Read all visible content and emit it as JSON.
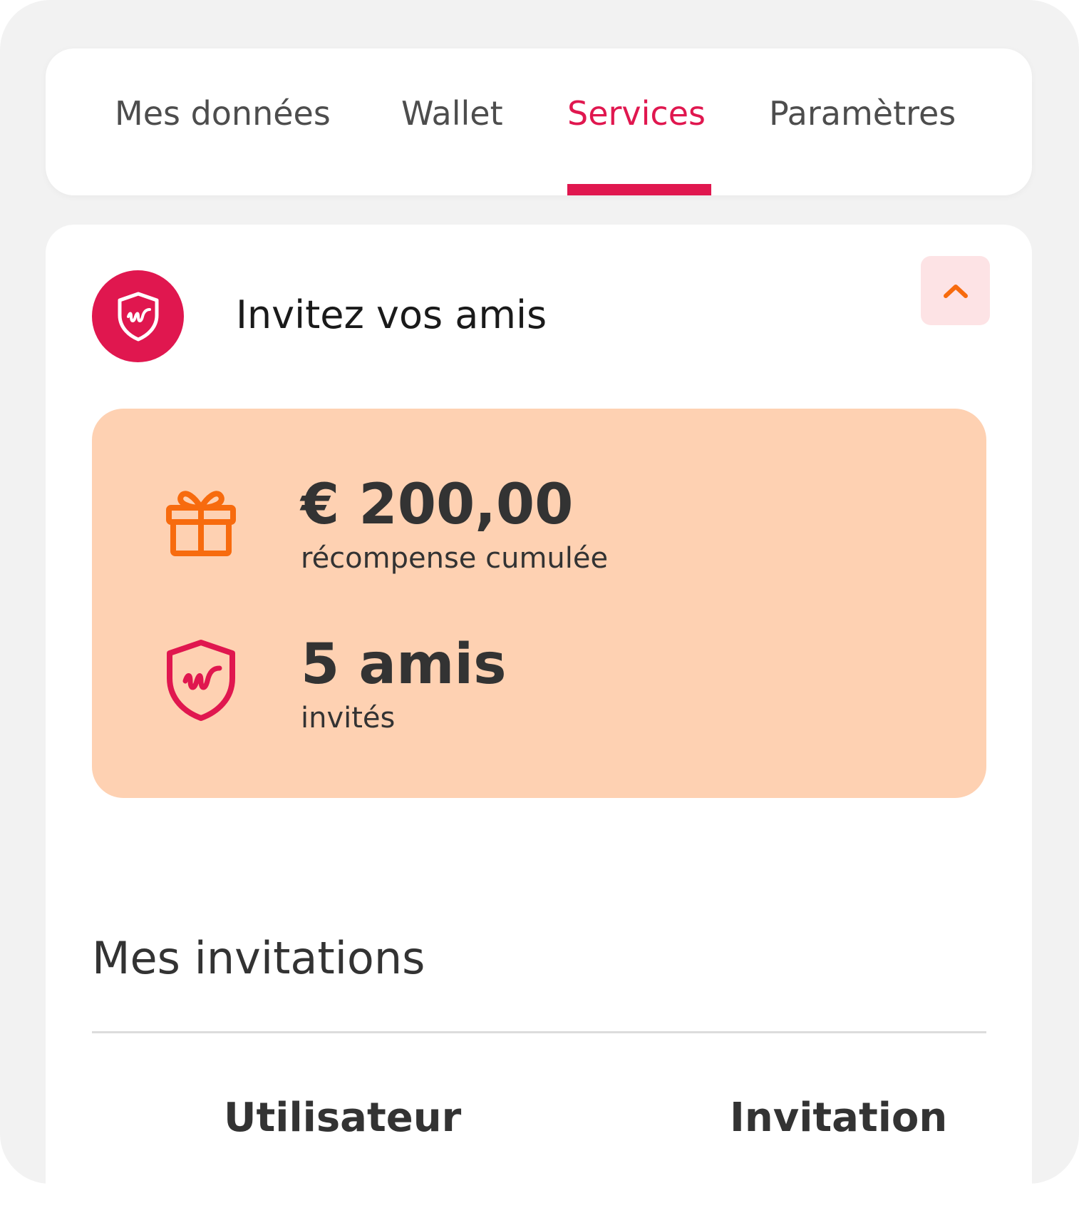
{
  "tabs": [
    {
      "label": "Mes données",
      "active": false
    },
    {
      "label": "Wallet",
      "active": false
    },
    {
      "label": "Services",
      "active": true
    },
    {
      "label": "Paramètres",
      "active": false
    }
  ],
  "section": {
    "title": "Invitez vos amis",
    "badge_icon": "shield-w-icon",
    "collapse_icon": "chevron-up-icon"
  },
  "stats": {
    "reward": {
      "value": "€ 200,00",
      "label": "récompense cumulée",
      "icon": "gift-icon"
    },
    "friends": {
      "value": "5 amis",
      "label": "invités",
      "icon": "shield-w-icon"
    }
  },
  "invitations": {
    "title": "Mes invitations",
    "columns": [
      "Utilisateur",
      "Invitation"
    ]
  },
  "colors": {
    "accent": "#e0174f",
    "orange": "#f76b0e",
    "stats_bg": "#fed1b2",
    "collapse_bg": "#fde3e5",
    "page_bg": "#f2f2f2"
  }
}
